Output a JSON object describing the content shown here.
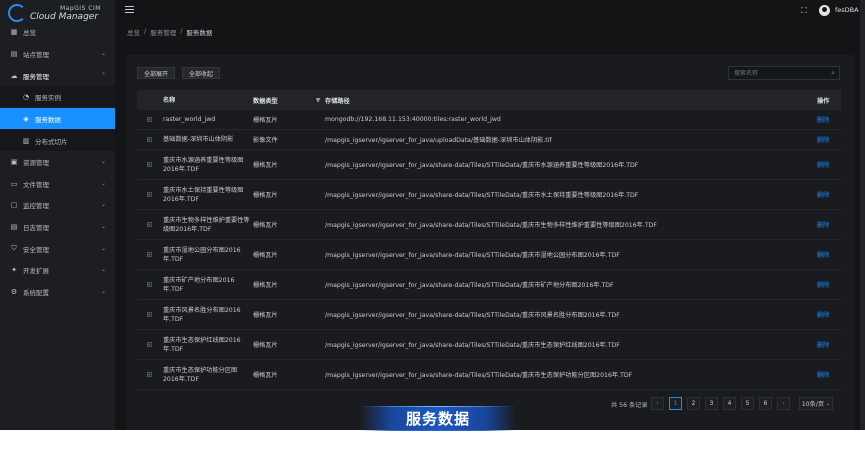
{
  "logo": {
    "line1": "MapGIS CIM",
    "line2": "Cloud Manager"
  },
  "sidebar": {
    "items": [
      {
        "label": "总览",
        "icon": "grid-icon",
        "chevron": false
      },
      {
        "label": "站点管理",
        "icon": "site-icon",
        "chevron": true
      },
      {
        "label": "服务管理",
        "icon": "cloud-icon",
        "chevron": true,
        "open": true
      },
      {
        "label": "服务实例",
        "icon": "instance-icon",
        "sub": true
      },
      {
        "label": "服务数据",
        "icon": "data-icon",
        "sub": true,
        "active": true
      },
      {
        "label": "分布式切片",
        "icon": "tile-icon",
        "sub": true
      },
      {
        "label": "资源管理",
        "icon": "resource-icon",
        "chevron": true
      },
      {
        "label": "文件管理",
        "icon": "folder-icon",
        "chevron": true
      },
      {
        "label": "监控管理",
        "icon": "monitor-icon",
        "chevron": true
      },
      {
        "label": "日志管理",
        "icon": "log-icon",
        "chevron": true
      },
      {
        "label": "安全管理",
        "icon": "shield-icon",
        "chevron": true
      },
      {
        "label": "开发扩展",
        "icon": "extend-icon",
        "chevron": true
      },
      {
        "label": "系统配置",
        "icon": "gear-icon",
        "chevron": true
      }
    ]
  },
  "header": {
    "username": "fesDBA"
  },
  "breadcrumb": {
    "home": "总览",
    "parent": "服务管理",
    "current": "服务数据",
    "sep": "/"
  },
  "toolbar": {
    "expand_all": "全部展开",
    "collapse_all": "全部收起",
    "search_placeholder": "搜索名称"
  },
  "table": {
    "headers": {
      "name": "名称",
      "type": "数据类型",
      "path": "存储路径",
      "op": "操作"
    },
    "rows": [
      {
        "name": "raster_world_jwd",
        "type": "栅格瓦片",
        "path": "mongodb://192.168.11.153:40000:tiles:raster_world_jwd",
        "op": "删除"
      },
      {
        "name": "基础数据-深圳市山体阴影",
        "type": "影像文件",
        "path": "/mapgis_igserver/igserver_for_java/uploadData/基础数据-深圳市山体阴影.tif",
        "op": "删除"
      },
      {
        "name": "重庆市水源涵养重要性等级图2016年.TDF",
        "type": "栅格瓦片",
        "path": "/mapgis_igserver/igserver_for_java/share-data/Tiles/STTileData/重庆市水源涵养重要性等级图2016年.TDF",
        "op": "删除"
      },
      {
        "name": "重庆市水土保持重要性等级图2016年.TDF",
        "type": "栅格瓦片",
        "path": "/mapgis_igserver/igserver_for_java/share-data/Tiles/STTileData/重庆市水土保持重要性等级图2016年.TDF",
        "op": "删除"
      },
      {
        "name": "重庆市生物多样性维护重要性等级图2016年.TDF",
        "type": "栅格瓦片",
        "path": "/mapgis_igserver/igserver_for_java/share-data/Tiles/STTileData/重庆市生物多样性维护重要性等级图2016年.TDF",
        "op": "删除"
      },
      {
        "name": "重庆市湿地公园分布图2016年.TDF",
        "type": "栅格瓦片",
        "path": "/mapgis_igserver/igserver_for_java/share-data/Tiles/STTileData/重庆市湿地公园分布图2016年.TDF",
        "op": "删除"
      },
      {
        "name": "重庆市矿产地分布图2016年.TDF",
        "type": "栅格瓦片",
        "path": "/mapgis_igserver/igserver_for_java/share-data/Tiles/STTileData/重庆市矿产地分布图2016年.TDF",
        "op": "删除"
      },
      {
        "name": "重庆市风景名胜分布图2016年.TDF",
        "type": "栅格瓦片",
        "path": "/mapgis_igserver/igserver_for_java/share-data/Tiles/STTileData/重庆市风景名胜分布图2016年.TDF",
        "op": "删除"
      },
      {
        "name": "重庆市生态保护红线图2016年.TDF",
        "type": "栅格瓦片",
        "path": "/mapgis_igserver/igserver_for_java/share-data/Tiles/STTileData/重庆市生态保护红线图2016年.TDF",
        "op": "删除"
      },
      {
        "name": "重庆市生态保护功能分区图2016年.TDF",
        "type": "栅格瓦片",
        "path": "/mapgis_igserver/igserver_for_java/share-data/Tiles/STTileData/重庆市生态保护功能分区图2016年.TDF",
        "op": "删除"
      }
    ]
  },
  "pagination": {
    "total": "共 56 条记录",
    "prev": "‹",
    "next": "›",
    "pages": [
      "1",
      "2",
      "3",
      "4",
      "5",
      "6"
    ],
    "current": "1",
    "page_size": "10条/页"
  },
  "banner": {
    "title": "服务数据"
  },
  "colors": {
    "accent": "#1890ff",
    "background": "#131416",
    "sidebar": "#1d1e21"
  }
}
